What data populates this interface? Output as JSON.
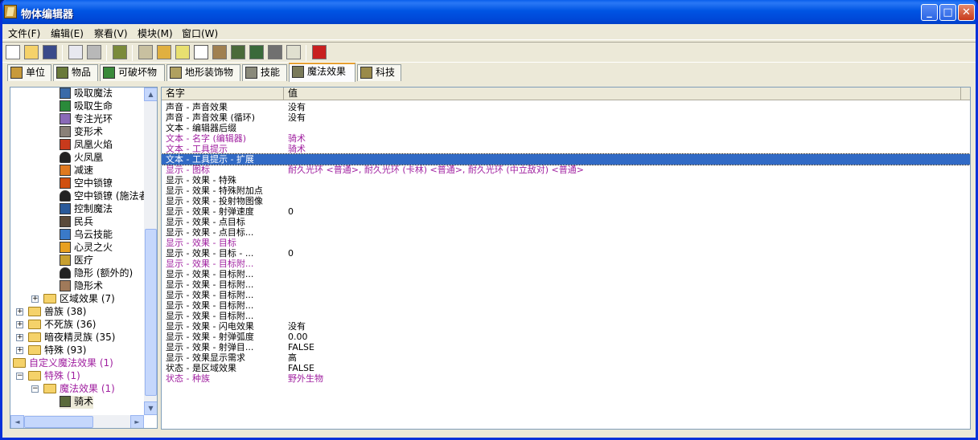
{
  "window": {
    "title": "物体编辑器",
    "min": "_",
    "max": "□",
    "close": "✕"
  },
  "menu": [
    "文件(F)",
    "编辑(E)",
    "察看(V)",
    "模块(M)",
    "窗口(W)"
  ],
  "tabs": [
    "单位",
    "物品",
    "可破坏物",
    "地形装饰物",
    "技能",
    "魔法效果",
    "科技"
  ],
  "active_tab": "魔法效果",
  "tree": {
    "spells": [
      "吸取魔法",
      "吸取生命",
      "专注光环",
      "变形术",
      "凤凰火焰",
      "火凤凰",
      "减速",
      "空中锁镣",
      "空中锁镣 (施法者)",
      "控制魔法",
      "民兵",
      "乌云技能",
      "心灵之火",
      "医疗",
      "隐形 (额外的)",
      "隐形术"
    ],
    "folders": [
      "区域效果 (7)",
      "兽族 (38)",
      "不死族 (36)",
      "暗夜精灵族 (35)",
      "特殊 (93)"
    ],
    "custom": [
      "自定义魔法效果 (1)",
      "特殊 (1)",
      "魔法效果 (1)",
      "骑术"
    ],
    "scroll_up": "▲",
    "scroll_down": "▼",
    "scroll_left": "◄",
    "scroll_right": "►"
  },
  "grid": {
    "col_name": "名字",
    "col_value": "值",
    "rows": [
      {
        "k": "声音 - 声音效果",
        "v": "没有"
      },
      {
        "k": "声音 - 声音效果 (循环)",
        "v": "没有"
      },
      {
        "k": "文本 - 编辑器后缀",
        "v": ""
      },
      {
        "k": "文本 - 名字 (编辑器)",
        "v": "骑术",
        "mod": true
      },
      {
        "k": "文本 - 工具提示",
        "v": "骑术",
        "mod": true
      },
      {
        "k": "文本 - 工具提示 - 扩展",
        "v": "",
        "sel": true
      },
      {
        "k": "显示 - 图标",
        "v": "耐久光环 <普通>, 耐久光环 (卡林) <普通>, 耐久光环 (中立敌对) <普通>",
        "mod": true
      },
      {
        "k": "显示 - 效果 - 特殊",
        "v": ""
      },
      {
        "k": "显示 - 效果 - 特殊附加点",
        "v": ""
      },
      {
        "k": "显示 - 效果 - 投射物图像",
        "v": ""
      },
      {
        "k": "显示 - 效果 - 射弹速度",
        "v": "0"
      },
      {
        "k": "显示 - 效果 - 点目标",
        "v": ""
      },
      {
        "k": "显示 - 效果 - 点目标...",
        "v": ""
      },
      {
        "k": "显示 - 效果 - 目标",
        "v": "",
        "mod": true
      },
      {
        "k": "显示 - 效果 - 目标 - ...",
        "v": "0"
      },
      {
        "k": "显示 - 效果 - 目标附...",
        "v": "",
        "mod": true
      },
      {
        "k": "显示 - 效果 - 目标附...",
        "v": ""
      },
      {
        "k": "显示 - 效果 - 目标附...",
        "v": ""
      },
      {
        "k": "显示 - 效果 - 目标附...",
        "v": ""
      },
      {
        "k": "显示 - 效果 - 目标附...",
        "v": ""
      },
      {
        "k": "显示 - 效果 - 目标附...",
        "v": ""
      },
      {
        "k": "显示 - 效果 - 闪电效果",
        "v": "没有"
      },
      {
        "k": "显示 - 效果 - 射弹弧度",
        "v": "0.00"
      },
      {
        "k": "显示 - 效果 - 射弹目...",
        "v": "FALSE"
      },
      {
        "k": "显示 - 效果显示需求",
        "v": "高"
      },
      {
        "k": "状态 - 是区域效果",
        "v": "FALSE"
      },
      {
        "k": "状态 - 种族",
        "v": "野外生物",
        "mod": true
      }
    ]
  },
  "colors": {
    "modified": "#a020a0",
    "selected": "#316ac5",
    "titlebar": "#0054e3"
  }
}
